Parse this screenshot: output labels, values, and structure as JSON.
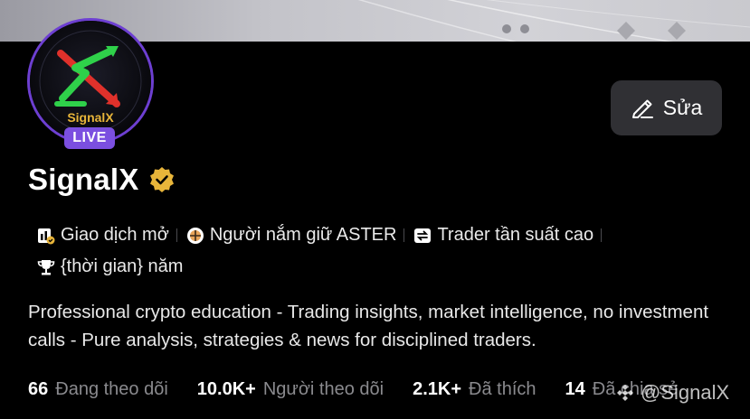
{
  "profile": {
    "name": "SignalX",
    "live_label": "LIVE",
    "logo_text": "SignalX",
    "verified_icon": "verified-badge-icon"
  },
  "actions": {
    "edit_label": "Sửa",
    "edit_icon": "pencil-icon"
  },
  "tags": [
    {
      "icon": "open-trades-icon",
      "label": "Giao dịch mở"
    },
    {
      "icon": "aster-token-icon",
      "label": "Người nắm giữ ASTER"
    },
    {
      "icon": "swap-icon",
      "label": "Trader tần suất cao"
    },
    {
      "icon": "trophy-icon",
      "label": "{thời gian} năm"
    }
  ],
  "bio": "Professional crypto education - Trading insights, market intelligence, no investment calls - Pure analysis, strategies & news for disciplined traders.",
  "stats": {
    "following": {
      "value": "66",
      "label": "Đang theo dõi"
    },
    "followers": {
      "value": "10.0K+",
      "label": "Người theo dõi"
    },
    "likes": {
      "value": "2.1K+",
      "label": "Đã thích"
    },
    "shares": {
      "value": "14",
      "label": "Đã chia sẻ"
    }
  },
  "watermark": {
    "text": "@SignalX",
    "icon": "binance-logo-icon"
  },
  "colors": {
    "live_badge": "#7b4fe0",
    "avatar_ring": "#6d3fd1",
    "verified": "#e8b53a",
    "background": "#000000",
    "edit_button": "#303034"
  }
}
